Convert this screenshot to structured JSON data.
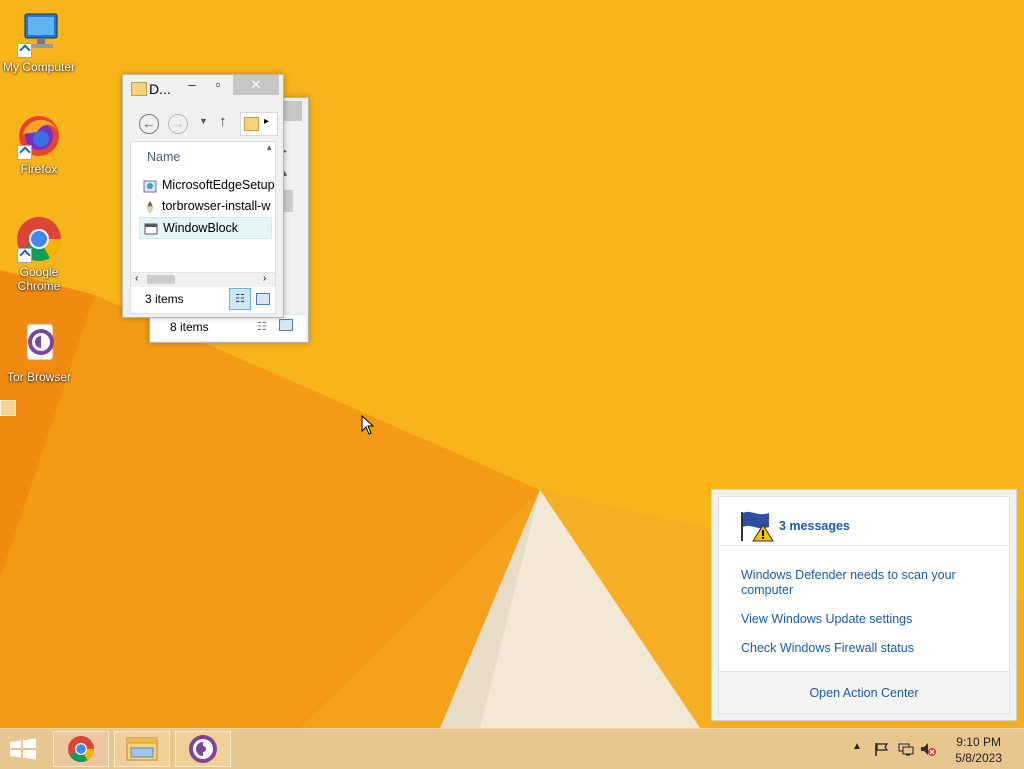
{
  "desktop": {
    "icons": [
      {
        "label": "My Computer"
      },
      {
        "label": "Firefox"
      },
      {
        "label": "Google Chrome"
      },
      {
        "label": "Tor Browser"
      }
    ]
  },
  "explorer_back": {
    "status": "8 items"
  },
  "explorer_front": {
    "title": "D...",
    "column_header": "Name",
    "files": [
      {
        "name": "MicrosoftEdgeSetup",
        "icon": "installer-icon"
      },
      {
        "name": "torbrowser-install-w",
        "icon": "tor-installer-icon"
      },
      {
        "name": "WindowBlock",
        "icon": "application-icon"
      }
    ],
    "status": "3 items"
  },
  "action_center": {
    "header": "3 messages",
    "messages": [
      "Windows Defender needs to scan your computer",
      "View Windows Update settings",
      "Check Windows Firewall status"
    ],
    "footer_link": "Open Action Center"
  },
  "taskbar": {
    "pinned": [
      "Google Chrome",
      "File Explorer",
      "Tor Browser"
    ],
    "clock_time": "9:10 PM",
    "clock_date": "5/8/2023"
  },
  "colors": {
    "background": "#f7b21a",
    "link": "#1a5ca8",
    "taskbar": "#e7c690"
  }
}
